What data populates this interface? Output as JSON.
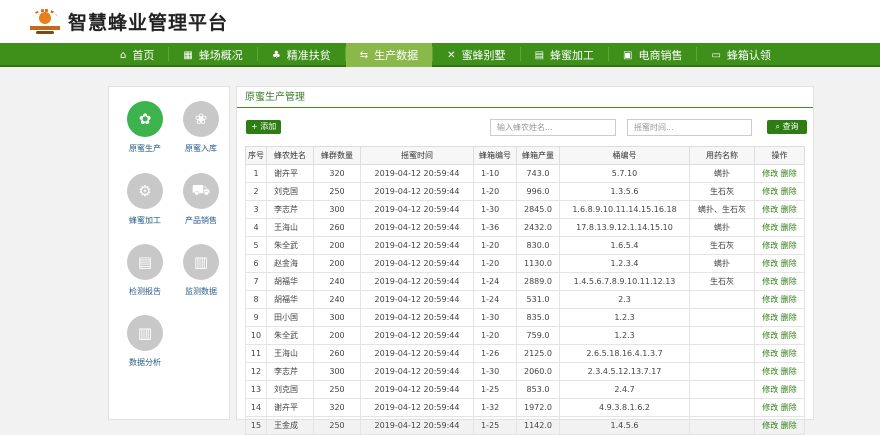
{
  "header": {
    "title": "智慧蜂业管理平台"
  },
  "nav": [
    {
      "label": "首页",
      "icon": "home-icon",
      "glyph": "⌂"
    },
    {
      "label": "蜂场概况",
      "icon": "chart-icon",
      "glyph": "▦"
    },
    {
      "label": "精准扶贫",
      "icon": "hands-icon",
      "glyph": "♣"
    },
    {
      "label": "生产数据",
      "icon": "flow-icon",
      "glyph": "⇆"
    },
    {
      "label": "蜜蜂别墅",
      "icon": "tools-icon",
      "glyph": "✕"
    },
    {
      "label": "蜂蜜加工",
      "icon": "factory-icon",
      "glyph": "▤"
    },
    {
      "label": "电商销售",
      "icon": "store-icon",
      "glyph": "▣"
    },
    {
      "label": "蜂箱认领",
      "icon": "monitor-icon",
      "glyph": "▭"
    }
  ],
  "sidebar": [
    {
      "label": "原蜜生产",
      "icon": "bee-icon",
      "glyph": "✿",
      "active": true
    },
    {
      "label": "原蜜入库",
      "icon": "honeybee-icon",
      "glyph": "❀"
    },
    {
      "label": "蜂蜜加工",
      "icon": "cart-icon",
      "glyph": "⚙"
    },
    {
      "label": "产品销售",
      "icon": "truck-icon",
      "glyph": "⛟"
    },
    {
      "label": "检测报告",
      "icon": "report-icon",
      "glyph": "▤"
    },
    {
      "label": "监测数据",
      "icon": "monitor-chart-icon",
      "glyph": "▥"
    },
    {
      "label": "数据分析",
      "icon": "analysis-icon",
      "glyph": "▥"
    }
  ],
  "main": {
    "title": "原蜜生产管理",
    "add_label": "+ 添加",
    "name_placeholder": "输入蜂农姓名...",
    "time_placeholder": "摇蜜时间...",
    "search_label": "查询"
  },
  "table": {
    "headers": [
      "序号",
      "蜂农姓名",
      "蜂群数量",
      "摇蜜时间",
      "蜂箱编号",
      "蜂箱产量",
      "桶编号",
      "用药名称",
      "操作"
    ],
    "edit_label": "修改",
    "delete_label": "删除",
    "rows": [
      [
        "1",
        "谢卉平",
        "320",
        "2019-04-12 20:59:44",
        "1-10",
        "743.0",
        "5.7.10",
        "螨扑"
      ],
      [
        "2",
        "刘克国",
        "250",
        "2019-04-12 20:59:44",
        "1-20",
        "996.0",
        "1.3.5.6",
        "生石灰"
      ],
      [
        "3",
        "李志芹",
        "300",
        "2019-04-12 20:59:44",
        "1-30",
        "2845.0",
        "1.6.8.9.10.11.14.15.16.18",
        "螨扑、生石灰"
      ],
      [
        "4",
        "王海山",
        "260",
        "2019-04-12 20:59:44",
        "1-36",
        "2432.0",
        "17.8.13.9.12.1.14.15.10",
        "螨扑"
      ],
      [
        "5",
        "朱全武",
        "200",
        "2019-04-12 20:59:44",
        "1-20",
        "830.0",
        "1.6.5.4",
        "生石灰"
      ],
      [
        "6",
        "赵金海",
        "200",
        "2019-04-12 20:59:44",
        "1-20",
        "1130.0",
        "1.2.3.4",
        "螨扑"
      ],
      [
        "7",
        "胡福华",
        "240",
        "2019-04-12 20:59:44",
        "1-24",
        "2889.0",
        "1.4.5.6.7.8.9.10.11.12.13",
        "生石灰"
      ],
      [
        "8",
        "胡福华",
        "240",
        "2019-04-12 20:59:44",
        "1-24",
        "531.0",
        "2.3",
        ""
      ],
      [
        "9",
        "田小国",
        "300",
        "2019-04-12 20:59:44",
        "1-30",
        "835.0",
        "1.2.3",
        ""
      ],
      [
        "10",
        "朱全武",
        "200",
        "2019-04-12 20:59:44",
        "1-20",
        "759.0",
        "1.2.3",
        ""
      ],
      [
        "11",
        "王海山",
        "260",
        "2019-04-12 20:59:44",
        "1-26",
        "2125.0",
        "2.6.5.18.16.4.1.3.7",
        ""
      ],
      [
        "12",
        "李志芹",
        "300",
        "2019-04-12 20:59:44",
        "1-30",
        "2060.0",
        "2.3.4.5.12.13.7.17",
        ""
      ],
      [
        "13",
        "刘克国",
        "250",
        "2019-04-12 20:59:44",
        "1-25",
        "853.0",
        "2.4.7",
        ""
      ],
      [
        "14",
        "谢卉平",
        "320",
        "2019-04-12 20:59:44",
        "1-32",
        "1972.0",
        "4.9.3.8.1.6.2",
        ""
      ],
      [
        "15",
        "王金成",
        "250",
        "2019-04-12 20:59:44",
        "1-25",
        "1142.0",
        "1.4.5.6",
        ""
      ]
    ]
  }
}
